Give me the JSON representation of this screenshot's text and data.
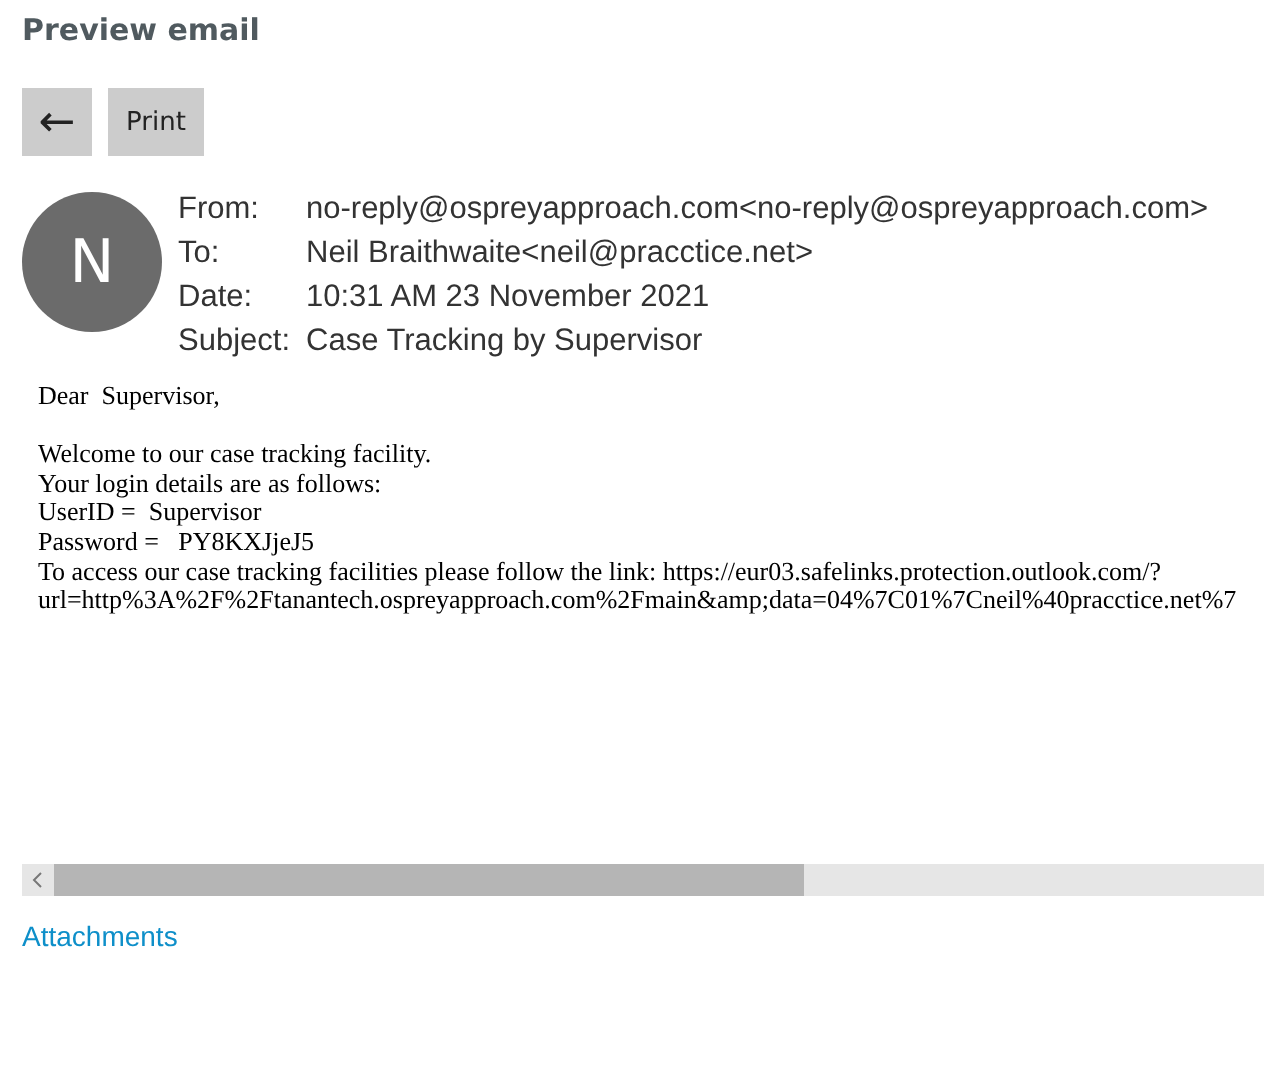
{
  "title": "Preview email",
  "toolbar": {
    "back": "←",
    "print": "Print"
  },
  "sender": {
    "initial": "N"
  },
  "headers": [
    {
      "label": "From:",
      "value": "no-reply@ospreyapproach.com<no-reply@ospreyapproach.com>"
    },
    {
      "label": "To:",
      "value": "Neil Braithwaite<neil@pracctice.net>"
    },
    {
      "label": "Date:",
      "value": "10:31 AM 23 November 2021"
    },
    {
      "label": "Subject:",
      "value": "Case Tracking by Supervisor"
    }
  ],
  "body": [
    [
      "Dear  Supervisor,"
    ],
    [
      "Welcome to our case tracking facility.",
      "Your login details are as follows:",
      "UserID =  Supervisor",
      "Password =   PY8KXJjeJ5",
      "To access our case tracking facilities please follow the link: https://eur03.safelinks.protection.outlook.com/?",
      "url=http%3A%2F%2Ftanantech.ospreyapproach.com%2Fmain&amp;data=04%7C01%7Cneil%40pracctice.net%7"
    ]
  ],
  "attachments": "Attachments"
}
